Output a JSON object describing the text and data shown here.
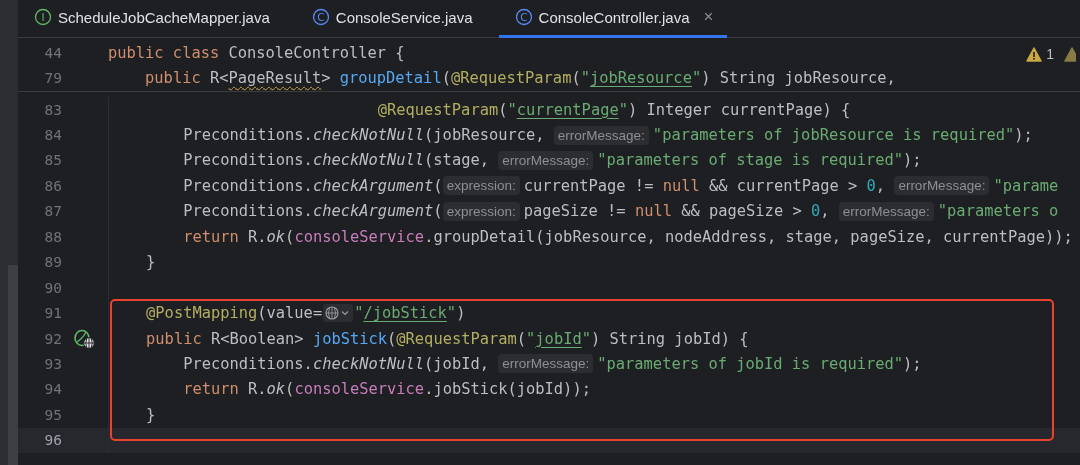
{
  "tabs": [
    {
      "label": "ScheduleJobCacheMapper.java",
      "icon_letter": "I",
      "kind": "interface",
      "selected": false
    },
    {
      "label": "ConsoleService.java",
      "icon_letter": "C",
      "kind": "class",
      "selected": false
    },
    {
      "label": "ConsoleController.java",
      "icon_letter": "C",
      "kind": "class",
      "selected": true,
      "close": "×"
    }
  ],
  "problems": {
    "warning_count": "1"
  },
  "sticky_lines": [
    {
      "number": "44",
      "parts": [
        {
          "kind": "code",
          "tokens": [
            {
              "t": "public class ",
              "kind": "kw"
            },
            {
              "t": "ConsoleController {",
              "kind": "plain"
            }
          ]
        }
      ]
    },
    {
      "number": "79",
      "parts": [
        {
          "kind": "code",
          "tokens": [
            {
              "t": "    public ",
              "kind": "kw"
            },
            {
              "t": "R<",
              "kind": "plain"
            },
            {
              "t": "PageResult",
              "kind": "plain",
              "warning": true
            },
            {
              "t": "> ",
              "kind": "plain"
            },
            {
              "t": "groupDetail",
              "kind": "fn"
            },
            {
              "t": "(",
              "kind": "plain"
            },
            {
              "t": "@RequestParam",
              "kind": "ann"
            },
            {
              "t": "(",
              "kind": "plain"
            },
            {
              "t": "\"",
              "kind": "str"
            },
            {
              "t": "jobResource",
              "kind": "str",
              "underlined": true
            },
            {
              "t": "\"",
              "kind": "str"
            },
            {
              "t": ") String jobResource,",
              "kind": "plain"
            }
          ]
        }
      ]
    }
  ],
  "lines": [
    {
      "number": "83",
      "current": false,
      "framed": false,
      "gutter_icon": false,
      "parts": [
        {
          "kind": "code",
          "tokens": [
            {
              "t": "                             @RequestParam",
              "kind": "ann"
            },
            {
              "t": "(",
              "kind": "plain"
            },
            {
              "t": "\"",
              "kind": "str"
            },
            {
              "t": "currentPage",
              "kind": "str",
              "underlined": true
            },
            {
              "t": "\"",
              "kind": "str"
            },
            {
              "t": ") Integer currentPage) {",
              "kind": "plain"
            }
          ]
        }
      ]
    },
    {
      "number": "84",
      "current": false,
      "framed": false,
      "gutter_icon": false,
      "parts": [
        {
          "kind": "code",
          "tokens": [
            {
              "t": "        Preconditions.",
              "kind": "plain"
            },
            {
              "t": "checkNotNull",
              "kind": "italic"
            },
            {
              "t": "(jobResource, ",
              "kind": "plain"
            }
          ]
        },
        {
          "kind": "hint",
          "text": "errorMessage:"
        },
        {
          "kind": "code",
          "tokens": [
            {
              "t": "\"parameters of jobResource is required\"",
              "kind": "str"
            },
            {
              "t": ");",
              "kind": "plain"
            }
          ]
        }
      ]
    },
    {
      "number": "85",
      "current": false,
      "framed": false,
      "gutter_icon": false,
      "parts": [
        {
          "kind": "code",
          "tokens": [
            {
              "t": "        Preconditions.",
              "kind": "plain"
            },
            {
              "t": "checkNotNull",
              "kind": "italic"
            },
            {
              "t": "(stage, ",
              "kind": "plain"
            }
          ]
        },
        {
          "kind": "hint",
          "text": "errorMessage:"
        },
        {
          "kind": "code",
          "tokens": [
            {
              "t": "\"parameters of stage is required\"",
              "kind": "str"
            },
            {
              "t": ");",
              "kind": "plain"
            }
          ]
        }
      ]
    },
    {
      "number": "86",
      "current": false,
      "framed": false,
      "gutter_icon": false,
      "parts": [
        {
          "kind": "code",
          "tokens": [
            {
              "t": "        Preconditions.",
              "kind": "plain"
            },
            {
              "t": "checkArgument",
              "kind": "italic"
            },
            {
              "t": "(",
              "kind": "plain"
            }
          ]
        },
        {
          "kind": "hint",
          "text": "expression:"
        },
        {
          "kind": "code",
          "tokens": [
            {
              "t": "currentPage != ",
              "kind": "plain"
            },
            {
              "t": "null",
              "kind": "kw"
            },
            {
              "t": " && currentPage > ",
              "kind": "plain"
            },
            {
              "t": "0",
              "kind": "num"
            },
            {
              "t": ", ",
              "kind": "plain"
            }
          ]
        },
        {
          "kind": "hint",
          "text": "errorMessage:"
        },
        {
          "kind": "code",
          "tokens": [
            {
              "t": "\"parame",
              "kind": "str"
            }
          ]
        }
      ]
    },
    {
      "number": "87",
      "current": false,
      "framed": false,
      "gutter_icon": false,
      "parts": [
        {
          "kind": "code",
          "tokens": [
            {
              "t": "        Preconditions.",
              "kind": "plain"
            },
            {
              "t": "checkArgument",
              "kind": "italic"
            },
            {
              "t": "(",
              "kind": "plain"
            }
          ]
        },
        {
          "kind": "hint",
          "text": "expression:"
        },
        {
          "kind": "code",
          "tokens": [
            {
              "t": "pageSize != ",
              "kind": "plain"
            },
            {
              "t": "null",
              "kind": "kw"
            },
            {
              "t": " && pageSize > ",
              "kind": "plain"
            },
            {
              "t": "0",
              "kind": "num"
            },
            {
              "t": ", ",
              "kind": "plain"
            }
          ]
        },
        {
          "kind": "hint",
          "text": "errorMessage:"
        },
        {
          "kind": "code",
          "tokens": [
            {
              "t": "\"parameters o",
              "kind": "str"
            }
          ]
        }
      ]
    },
    {
      "number": "88",
      "current": false,
      "framed": false,
      "gutter_icon": false,
      "parts": [
        {
          "kind": "code",
          "tokens": [
            {
              "t": "        return ",
              "kind": "kw"
            },
            {
              "t": "R.",
              "kind": "plain"
            },
            {
              "t": "ok",
              "kind": "italic"
            },
            {
              "t": "(",
              "kind": "plain"
            },
            {
              "t": "consoleService",
              "kind": "field"
            },
            {
              "t": ".groupDetail(jobResource, nodeAddress, stage, pageSize, currentPage));",
              "kind": "plain"
            }
          ]
        }
      ]
    },
    {
      "number": "89",
      "current": false,
      "framed": false,
      "gutter_icon": false,
      "parts": [
        {
          "kind": "code",
          "tokens": [
            {
              "t": "    }",
              "kind": "plain"
            }
          ]
        }
      ]
    },
    {
      "number": "90",
      "current": false,
      "framed": false,
      "gutter_icon": false
    },
    {
      "number": "91",
      "current": false,
      "framed": true,
      "gutter_icon": false,
      "parts": [
        {
          "kind": "code",
          "tokens": [
            {
              "t": "    @PostMapping",
              "kind": "ann"
            },
            {
              "t": "(value=",
              "kind": "plain"
            }
          ]
        },
        {
          "kind": "globe"
        },
        {
          "kind": "code",
          "tokens": [
            {
              "t": "\"",
              "kind": "str"
            },
            {
              "t": "/jobStick",
              "kind": "str",
              "underlined": true
            },
            {
              "t": "\"",
              "kind": "str"
            },
            {
              "t": ")",
              "kind": "plain"
            }
          ]
        }
      ]
    },
    {
      "number": "92",
      "current": false,
      "framed": true,
      "gutter_icon": true,
      "parts": [
        {
          "kind": "code",
          "tokens": [
            {
              "t": "    public ",
              "kind": "kw"
            },
            {
              "t": "R<Boolean> ",
              "kind": "plain"
            },
            {
              "t": "jobStick",
              "kind": "fn"
            },
            {
              "t": "(",
              "kind": "plain"
            },
            {
              "t": "@RequestParam",
              "kind": "ann"
            },
            {
              "t": "(",
              "kind": "plain"
            },
            {
              "t": "\"",
              "kind": "str"
            },
            {
              "t": "jobId",
              "kind": "str",
              "underlined": true
            },
            {
              "t": "\"",
              "kind": "str"
            },
            {
              "t": ") String jobId) {",
              "kind": "plain"
            }
          ]
        }
      ]
    },
    {
      "number": "93",
      "current": false,
      "framed": true,
      "gutter_icon": false,
      "parts": [
        {
          "kind": "code",
          "tokens": [
            {
              "t": "        Preconditions.",
              "kind": "plain"
            },
            {
              "t": "checkNotNull",
              "kind": "italic"
            },
            {
              "t": "(jobId, ",
              "kind": "plain"
            }
          ]
        },
        {
          "kind": "hint",
          "text": "errorMessage:"
        },
        {
          "kind": "code",
          "tokens": [
            {
              "t": "\"parameters of jobId is required\"",
              "kind": "str"
            },
            {
              "t": ");",
              "kind": "plain"
            }
          ]
        }
      ]
    },
    {
      "number": "94",
      "current": false,
      "framed": true,
      "gutter_icon": false,
      "parts": [
        {
          "kind": "code",
          "tokens": [
            {
              "t": "        return ",
              "kind": "kw"
            },
            {
              "t": "R.",
              "kind": "plain"
            },
            {
              "t": "ok",
              "kind": "italic"
            },
            {
              "t": "(",
              "kind": "plain"
            },
            {
              "t": "consoleService",
              "kind": "field"
            },
            {
              "t": ".jobStick(jobId));",
              "kind": "plain"
            }
          ]
        }
      ]
    },
    {
      "number": "95",
      "current": false,
      "framed": true,
      "gutter_icon": false,
      "parts": [
        {
          "kind": "code",
          "tokens": [
            {
              "t": "    }",
              "kind": "plain"
            }
          ]
        }
      ]
    },
    {
      "number": "96",
      "current": true,
      "framed": false,
      "gutter_icon": false
    }
  ]
}
